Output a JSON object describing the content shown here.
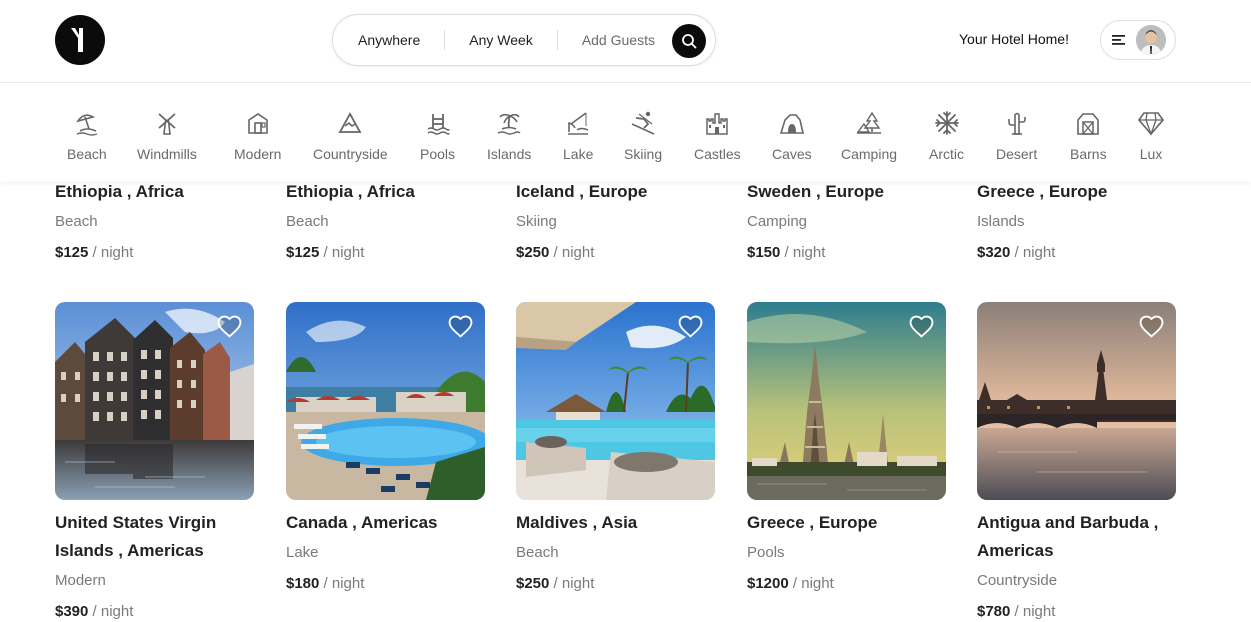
{
  "header": {
    "logo_icon": "brand-logo-icon",
    "search": {
      "where": "Anywhere",
      "when": "Any Week",
      "guests": "Add Guests",
      "icon": "search-icon"
    },
    "host_link": "Your Hotel Home!",
    "menu_icon": "hamburger-icon"
  },
  "categories": [
    {
      "label": "Beach",
      "icon": "beach-icon"
    },
    {
      "label": "Windmills",
      "icon": "windmill-icon"
    },
    {
      "label": "Modern",
      "icon": "modern-house-icon"
    },
    {
      "label": "Countryside",
      "icon": "mountain-icon"
    },
    {
      "label": "Pools",
      "icon": "pool-icon"
    },
    {
      "label": "Islands",
      "icon": "island-icon"
    },
    {
      "label": "Lake",
      "icon": "lake-icon"
    },
    {
      "label": "Skiing",
      "icon": "skiing-icon"
    },
    {
      "label": "Castles",
      "icon": "castle-icon"
    },
    {
      "label": "Caves",
      "icon": "cave-icon"
    },
    {
      "label": "Camping",
      "icon": "camping-icon"
    },
    {
      "label": "Arctic",
      "icon": "snowflake-icon"
    },
    {
      "label": "Desert",
      "icon": "cactus-icon"
    },
    {
      "label": "Barns",
      "icon": "barn-icon"
    },
    {
      "label": "Lux",
      "icon": "diamond-icon"
    }
  ],
  "price_suffix": "/ night",
  "listings_top": [
    {
      "location": "Ethiopia , Africa",
      "type": "Beach",
      "price": "$125"
    },
    {
      "location": "Ethiopia , Africa",
      "type": "Beach",
      "price": "$125"
    },
    {
      "location": "Iceland , Europe",
      "type": "Skiing",
      "price": "$250"
    },
    {
      "location": "Sweden , Europe",
      "type": "Camping",
      "price": "$150"
    },
    {
      "location": "Greece , Europe",
      "type": "Islands",
      "price": "$320"
    }
  ],
  "listings_bottom": [
    {
      "location": "United States Virgin Islands , Americas",
      "type": "Modern",
      "price": "$390",
      "photo": "canal-houses"
    },
    {
      "location": "Canada , Americas",
      "type": "Lake",
      "price": "$180",
      "photo": "resort-pool"
    },
    {
      "location": "Maldives , Asia",
      "type": "Beach",
      "price": "$250",
      "photo": "tropical-pool"
    },
    {
      "location": "Greece , Europe",
      "type": "Pools",
      "price": "$1200",
      "photo": "temple"
    },
    {
      "location": "Antigua and Barbuda , Americas",
      "type": "Countryside",
      "price": "$780",
      "photo": "city-river"
    }
  ]
}
